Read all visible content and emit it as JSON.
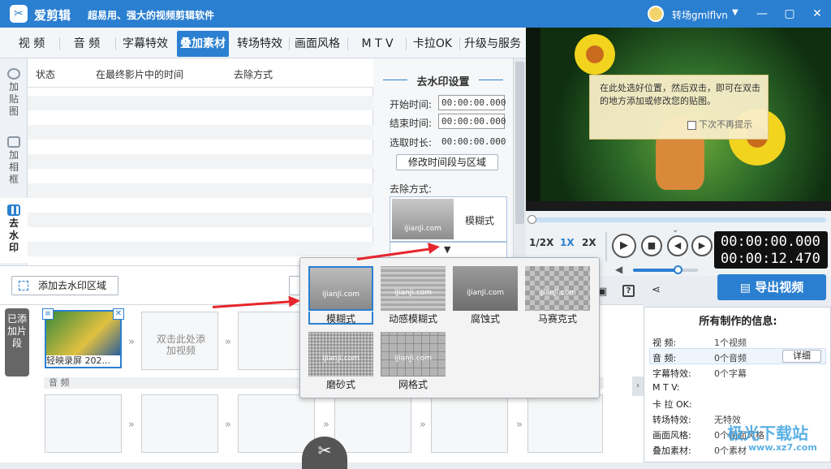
{
  "app": {
    "name": "爱剪辑",
    "slogan": "超易用、强大的视频剪辑软件",
    "user": "转场gmlflvn"
  },
  "window_controls": {
    "min": "—",
    "max": "▢",
    "close": "✕"
  },
  "tabs": [
    {
      "label": "视  频"
    },
    {
      "label": "音  频"
    },
    {
      "label": "字幕特效"
    },
    {
      "label": "叠加素材"
    },
    {
      "label": "转场特效"
    },
    {
      "label": "画面风格"
    },
    {
      "label": "M T V"
    },
    {
      "label": "卡拉OK"
    },
    {
      "label": "升级与服务"
    }
  ],
  "leftnav": [
    {
      "label": "加贴图"
    },
    {
      "label": "加相框"
    },
    {
      "label": "去水印"
    }
  ],
  "table": {
    "headers": [
      "状态",
      "在最终影片中的时间",
      "去除方式"
    ]
  },
  "settings": {
    "title": "去水印设置",
    "start_label": "开始时间:",
    "start_value": "00:00:00.000",
    "end_label": "结束时间:",
    "end_value": "00:00:00.000",
    "dur_label": "选取时长:",
    "dur_value": "00:00:00.000",
    "modify_button": "修改时间段与区域",
    "method_label": "去除方式:",
    "selected_method": "模糊式",
    "thumb_text": "iJianJi.com",
    "dropdown_arrow": "▼"
  },
  "addbar": {
    "add_button": "添加去水印区域"
  },
  "timeline": {
    "side_label": "已添加片段",
    "clip1": "轻映录屏 202...",
    "placeholder": "双击此处添加视频",
    "audio_label": "音 频",
    "arrow": "»"
  },
  "preview": {
    "tooltip": "在此处选好位置，然后双击，即可在双击的地方添加或修改您的贴图。",
    "no_remind": "下次不再提示"
  },
  "player": {
    "speeds": [
      "1/2X",
      "1X",
      "2X"
    ],
    "current_time": "00:00:00.000",
    "total_time": "00:00:12.470",
    "volume_level": 0.7
  },
  "export": {
    "label": "导出视频"
  },
  "info": {
    "title": "所有制作的信息:",
    "rows": [
      {
        "k": "视    频:",
        "v": "1个视频"
      },
      {
        "k": "音    频:",
        "v": "0个音频"
      },
      {
        "k": "字幕特效:",
        "v": "0个字幕"
      },
      {
        "k": "M  T  V:",
        "v": ""
      },
      {
        "k": "卡 拉 OK:",
        "v": ""
      },
      {
        "k": "转场特效:",
        "v": "无特效"
      },
      {
        "k": "画面风格:",
        "v": "0个画面风格"
      },
      {
        "k": "叠加素材:",
        "v": "0个素材"
      }
    ],
    "detail_button": "详细"
  },
  "popup": {
    "items": [
      {
        "label": "模糊式"
      },
      {
        "label": "动感模糊式"
      },
      {
        "label": "腐蚀式"
      },
      {
        "label": "马赛克式"
      },
      {
        "label": "磨砂式"
      },
      {
        "label": "网格式"
      }
    ],
    "thumb_text": "iJianJi.com"
  },
  "watermark": {
    "text": "极光下载站",
    "url": "www.xz7.com"
  },
  "icons": {
    "scissor": "✂"
  }
}
